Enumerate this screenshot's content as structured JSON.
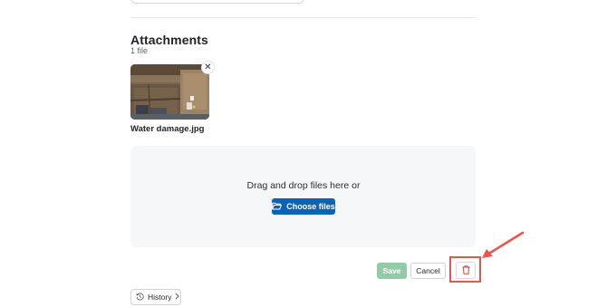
{
  "attachments": {
    "title": "Attachments",
    "count": "1 file",
    "files": [
      {
        "name": "Water damage.jpg",
        "remove_icon": "close-icon"
      }
    ]
  },
  "dropzone": {
    "text": "Drag and drop files here or",
    "choose_label": "Choose files",
    "choose_icon": "folder-open-icon"
  },
  "actions": {
    "save_label": "Save",
    "cancel_label": "Cancel",
    "delete_icon": "trash-icon"
  },
  "footer": {
    "history_label": "History",
    "history_icon": "history-icon"
  },
  "colors": {
    "primary": "#0b63b6",
    "save_disabled": "#93cba8",
    "danger": "#e5574c",
    "annotation": "#e5574c"
  }
}
